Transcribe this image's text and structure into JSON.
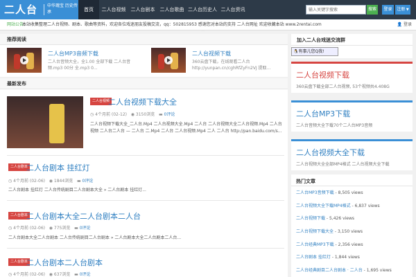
{
  "nav": {
    "logo_main": "二人台",
    "logo_sub": "中华瑰宝 历史传承",
    "items": [
      "首页",
      "二人台视频",
      "二人台剧本",
      "二人台歌曲",
      "二人台历史人物",
      "二人台资讯"
    ],
    "search_placeholder": "输入关键字搜索",
    "search_btn": "搜索",
    "login": "登录",
    "register": "注册"
  },
  "notice": {
    "label": "网站公告：",
    "text": "本站收集整理二人台视频、剧本、歌曲等资料，欢迎各位戏迷朋友投稿交流，qq：502815953 感谢您对本站的支持 二人台网址 欢迎收藏本站 www.2rentai.com",
    "user": "登录"
  },
  "recommend": {
    "heading": "推荐阅读",
    "items": [
      {
        "title": "二人台MP3音频下载",
        "desc": "二人台音频大全，全1.00 全部下载 二人台音频.mp3 00分 全.mp3 0..."
      },
      {
        "title": "二人台视频下载",
        "desc": "360云盘下载，在线观看二人台 http://yunpan.cn/cghRfZyFn2VJ 提取..."
      }
    ]
  },
  "latest": {
    "heading": "最新发布",
    "articles": [
      {
        "cat": "二人台视频",
        "title": "二人台视频下载大全",
        "date": "4个月前 (02-12)",
        "views": "3150浏览",
        "comments": "0评论",
        "desc": "二人台视频下载大全_二人台.Mp4 二人台视频大全.Mp4 二人台 二人台视频大全二人台视频.Mp4 二人台视频 二人台二人台 — 二人台 二.Mp4 二人台 二人台视频.Mp4 二人 二人台 http://pan.baidu.com/s..."
      },
      {
        "cat": "二人台剧本",
        "title": "二人台剧本 挂红灯",
        "date": "4个月前 (02-06)",
        "views": "1844浏览",
        "comments": "0评论",
        "desc": "二人台剧本 挂红灯 二人台传统剧目二人台剧本大全 » 二人台剧本 挂红灯..."
      },
      {
        "cat": "二人台剧本",
        "title": "二人台剧本大全二人台剧本二人台",
        "date": "4个月前 (02-06)",
        "views": "775浏览",
        "comments": "0评论",
        "desc": "二人台剧本大全二人台剧本 二人台传统剧目二人台剧本 » 二人台剧本大全二人台剧本二人台..."
      },
      {
        "cat": "二人台剧本",
        "title": "二人台剧本二人台剧本",
        "date": "4个月前 (02-06)",
        "views": "637浏览",
        "comments": "0评论",
        "desc": ""
      }
    ]
  },
  "sidebar": {
    "qrcode_heading": "加入二人台戏迷交流群",
    "qq_badge": "有事儿您Q我!",
    "blocks": [
      {
        "title": "二人台视频下载",
        "desc": "360云盘下载全部二人台视频, 53个视频共4.408G",
        "color": "#d64541"
      },
      {
        "title": "二人台MP3下载",
        "desc": "二人台音频大全下载70个二人台MP3音频",
        "color": "#3a8fd6"
      },
      {
        "title": "二人台视频大全下载",
        "desc": "二人台视频大全全部MP4格式 二人台视频大全下载",
        "color": "#3a8fd6"
      }
    ],
    "popular_heading": "热门文章",
    "popular": [
      {
        "title": "二人台MP3音频下载",
        "views": " - 8,505 views"
      },
      {
        "title": "二人台视频大全下载MP4格式",
        "views": " - 6,837 views"
      },
      {
        "title": "二人台视频下载",
        "views": " - 5,426 views"
      },
      {
        "title": "二人台视频下载大全",
        "views": " - 3,150 views"
      },
      {
        "title": "二人台经典MP3下载",
        "views": " - 2,356 views"
      },
      {
        "title": "二人台剧本 挂红灯",
        "views": " - 1,844 views"
      },
      {
        "title": "二人台经典剧目二人台剧本 · 二人台",
        "views": " - 1,695 views"
      }
    ]
  }
}
